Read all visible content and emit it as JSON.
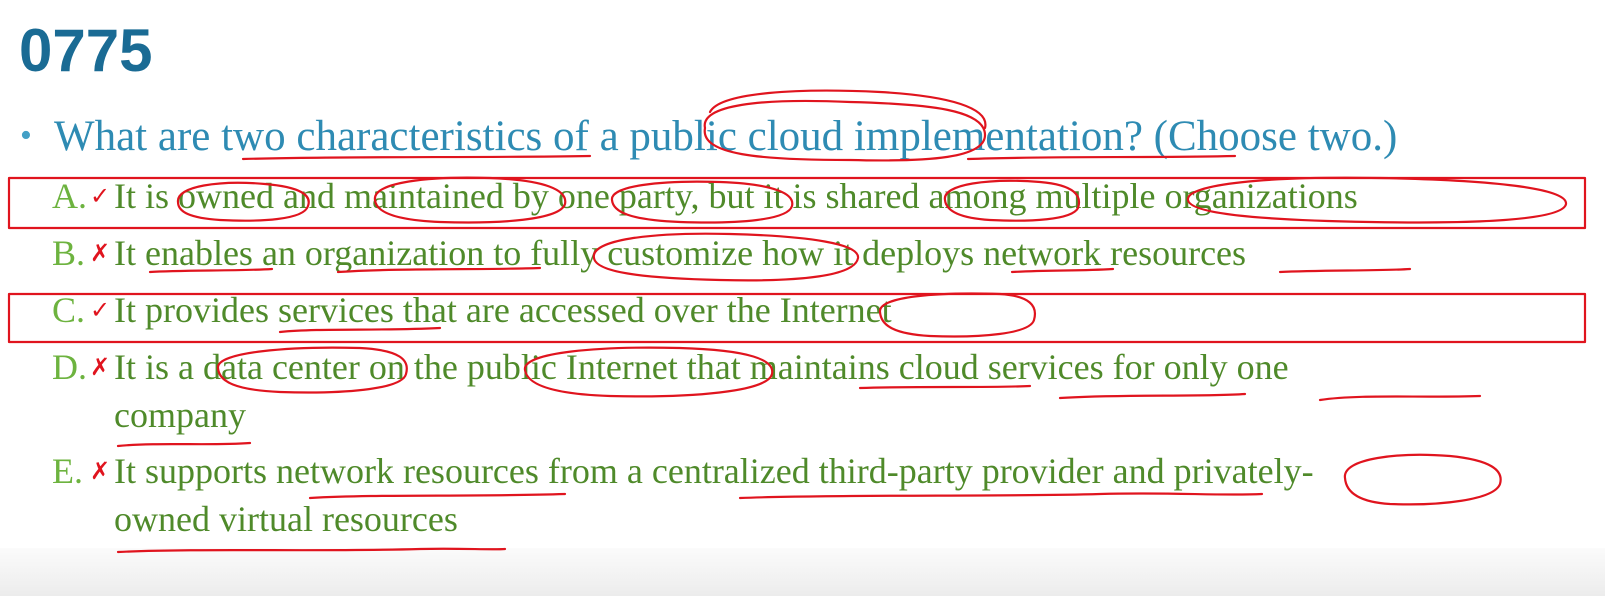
{
  "question_number": "0775",
  "question": {
    "bullet": "•",
    "text": "What are two characteristics of a public cloud implementation? (Choose two.)"
  },
  "options": [
    {
      "letter": "A.",
      "mark": "✓",
      "lines": [
        "It is owned and maintained by one party, but it is shared among multiple organizations"
      ]
    },
    {
      "letter": "B.",
      "mark": "✗",
      "lines": [
        "It enables an organization to fully customize how it deploys network resources"
      ]
    },
    {
      "letter": "C.",
      "mark": "✓",
      "lines": [
        "It provides services that are accessed over the Internet"
      ]
    },
    {
      "letter": "D.",
      "mark": "✗",
      "lines": [
        "It is a data center on the public Internet that maintains cloud services for only one",
        "company"
      ]
    },
    {
      "letter": "E.",
      "mark": "✗",
      "lines": [
        "It supports network resources from a centralized third-party provider and privately-",
        "owned virtual resources"
      ]
    }
  ],
  "colors": {
    "title": "#1a6b94",
    "question": "#2e8bb3",
    "option_text": "#4f8a2a",
    "option_letter": "#6db33f",
    "annotation": "#e0141e"
  }
}
